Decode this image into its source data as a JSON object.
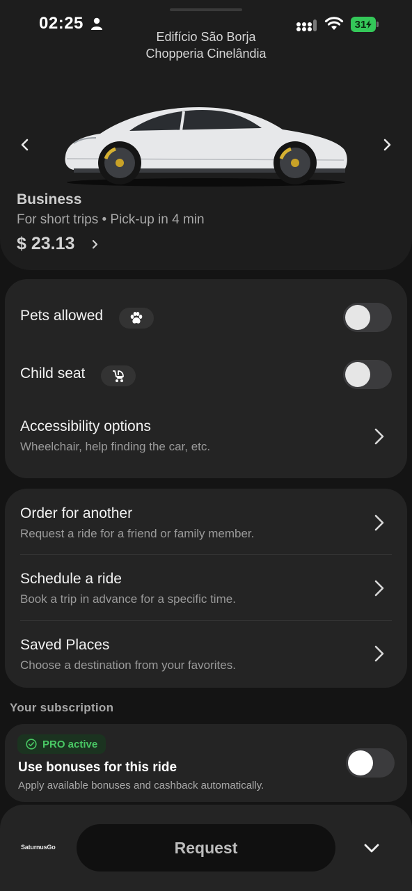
{
  "status_bar": {
    "time": "02:25",
    "battery": "31"
  },
  "header": {
    "address_line1": "Edifício São Borja",
    "address_line2": "Chopperia Cinelândia"
  },
  "ride_class": {
    "name": "Business",
    "description": "For short trips • Pick-up in 4 min",
    "price": "$ 23.13"
  },
  "options": [
    {
      "label": "Pets allowed",
      "icon": "paw-icon",
      "enabled": false
    },
    {
      "label": "Child seat",
      "icon": "stroller-icon",
      "enabled": false
    }
  ],
  "accessibility": {
    "title": "Accessibility options",
    "subtitle": "Wheelchair, help finding the car, etc."
  },
  "actions": [
    {
      "title": "Order for another",
      "subtitle": "Request a ride for a friend or family member."
    },
    {
      "title": "Schedule a ride",
      "subtitle": "Book a trip in advance for a specific time."
    },
    {
      "title": "Saved Places",
      "subtitle": "Choose a destination from your favorites."
    }
  ],
  "subscription": {
    "section_label": "Your subscription",
    "badge": "PRO active",
    "title": "Use bonuses for this ride",
    "description": "Apply available bonuses and cashback automatically.",
    "enabled": false
  },
  "bottom_bar": {
    "brand": "SaturnusGo",
    "request_label": "Request"
  },
  "colors": {
    "accent_green": "#49c764",
    "battery_green": "#34c759",
    "card_bg": "#242424"
  }
}
